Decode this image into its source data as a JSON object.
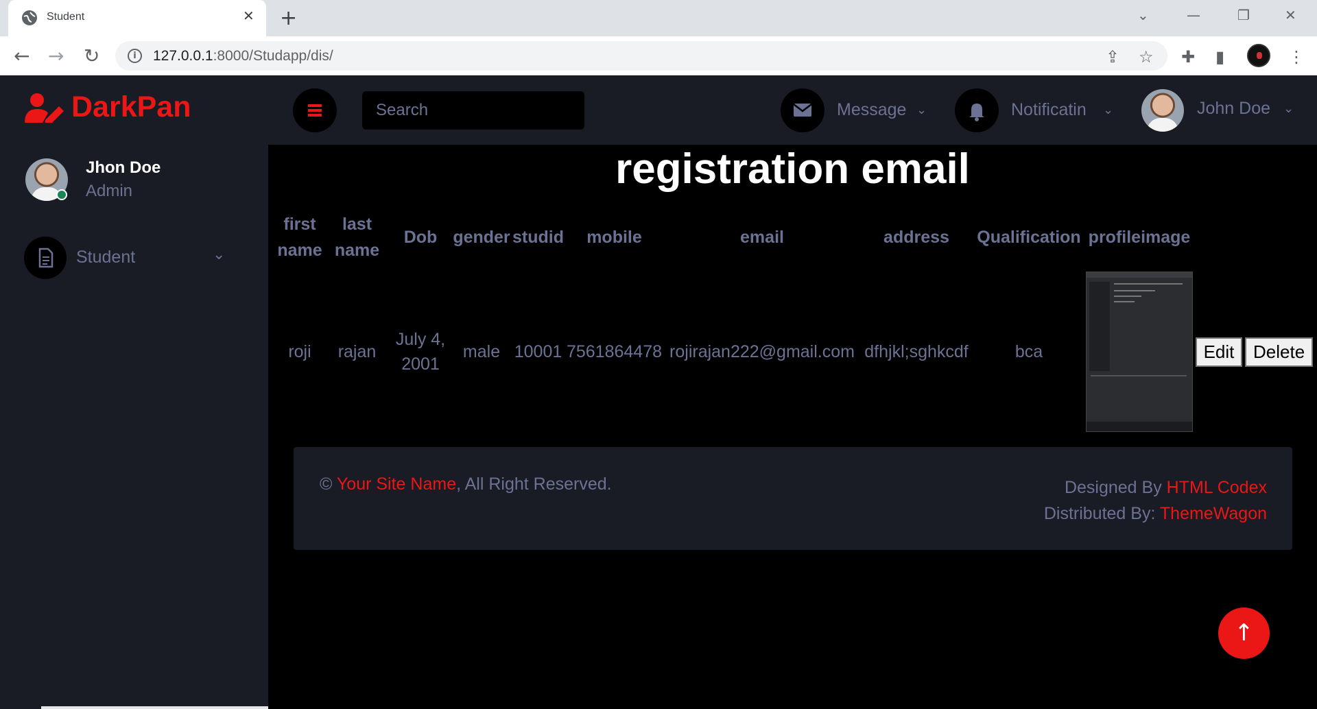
{
  "browser": {
    "tab_title": "Student",
    "tab_close": "✕",
    "new_tab": "+",
    "url_host": "127.0.0.1",
    "url_rest": ":8000/Studapp/dis/",
    "icons": [
      "globe-icon",
      "back-icon",
      "forward-icon",
      "reload-icon",
      "info-icon",
      "share-icon",
      "star-icon",
      "extensions-icon",
      "sidepanel-icon",
      "profile-icon",
      "menu-icon"
    ]
  },
  "brand": {
    "name": "DarkPan",
    "color": "#eb1616"
  },
  "sidebar": {
    "user_name": "Jhon Doe",
    "user_role": "Admin",
    "items": [
      {
        "label": "Student",
        "icon": "file-icon"
      }
    ]
  },
  "topnav": {
    "search_placeholder": "Search",
    "message_label": "Message",
    "notification_label": "Notificatin",
    "profile_label": "John Doe"
  },
  "main": {
    "title": "registration email",
    "table": {
      "headers": [
        "first name",
        "last name",
        "Dob",
        "gender",
        "studid",
        "mobile",
        "email",
        "address",
        "Qualification",
        "profileimage"
      ],
      "rows": [
        {
          "first_name": "roji",
          "last_name": "rajan",
          "dob": "July 4, 2001",
          "gender": "male",
          "studid": "10001",
          "mobile": "7561864478",
          "email": "rojirajan222@gmail.com",
          "address": "dfhjkl;sghkcdf",
          "qualification": "bca",
          "edit_label": "Edit",
          "delete_label": "Delete"
        }
      ]
    }
  },
  "footer": {
    "copyright_symbol": "©",
    "site_name": "Your Site Name",
    "rights": ", All Right Reserved.",
    "designed_by": "Designed By ",
    "designer": "HTML Codex",
    "distributed_by": "Distributed By: ",
    "distributor": "ThemeWagon"
  },
  "back_to_top": "↑"
}
